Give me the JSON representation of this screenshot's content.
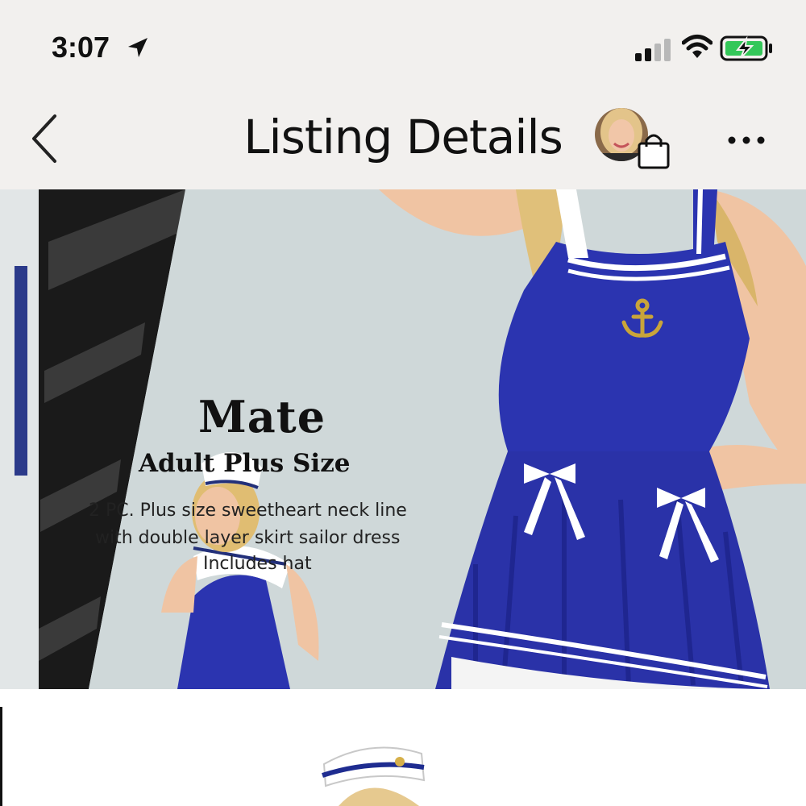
{
  "status_bar": {
    "time": "3:07"
  },
  "nav": {
    "title": "Listing Details"
  },
  "package": {
    "title": "Mate",
    "subtitle": "Adult Plus Size",
    "description_lines": [
      "2 PC. Plus size sweetheart neck line",
      "with double layer skirt sailor dress",
      "Includes hat"
    ]
  },
  "colors": {
    "bar_bg": "#f2f0ee",
    "dress_blue": "#2b34b0",
    "package_bg": "#d4dcdd",
    "battery_green": "#34c759"
  },
  "icons": [
    "location-arrow-icon",
    "signal-icon",
    "wifi-icon",
    "battery-icon",
    "back-chevron-icon",
    "shopping-bag-icon",
    "more-icon"
  ]
}
